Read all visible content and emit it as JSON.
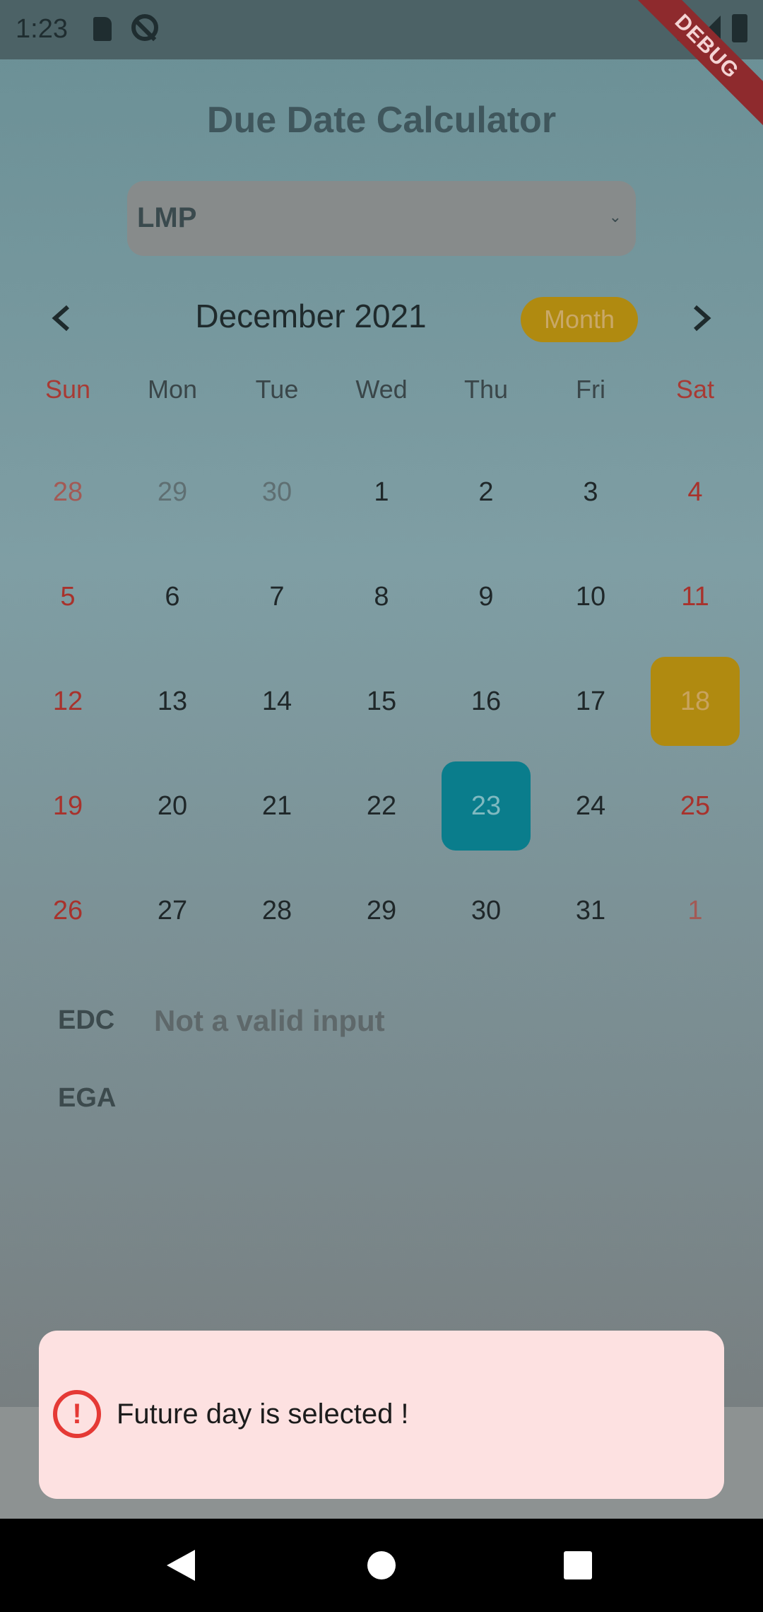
{
  "status_bar": {
    "time": "1:23",
    "debug_label": "DEBUG"
  },
  "app": {
    "title": "Due Date Calculator"
  },
  "dropdown": {
    "selected": "LMP"
  },
  "calendar": {
    "month_title": "December 2021",
    "view_mode": "Month",
    "weekdays": [
      "Sun",
      "Mon",
      "Tue",
      "Wed",
      "Thu",
      "Fri",
      "Sat"
    ],
    "days": [
      "28",
      "29",
      "30",
      "1",
      "2",
      "3",
      "4",
      "5",
      "6",
      "7",
      "8",
      "9",
      "10",
      "11",
      "12",
      "13",
      "14",
      "15",
      "16",
      "17",
      "18",
      "19",
      "20",
      "21",
      "22",
      "23",
      "24",
      "25",
      "26",
      "27",
      "28",
      "29",
      "30",
      "31",
      "1"
    ],
    "today": "23",
    "selected": "18",
    "colors": {
      "today": "#0a7d8c",
      "selected": "#b08a10",
      "weekend": "#a8322c"
    }
  },
  "results": {
    "edc_label": "EDC",
    "edc_value": "Not a valid input",
    "ega_label": "EGA"
  },
  "snackbar": {
    "message": "Future day is selected !"
  }
}
